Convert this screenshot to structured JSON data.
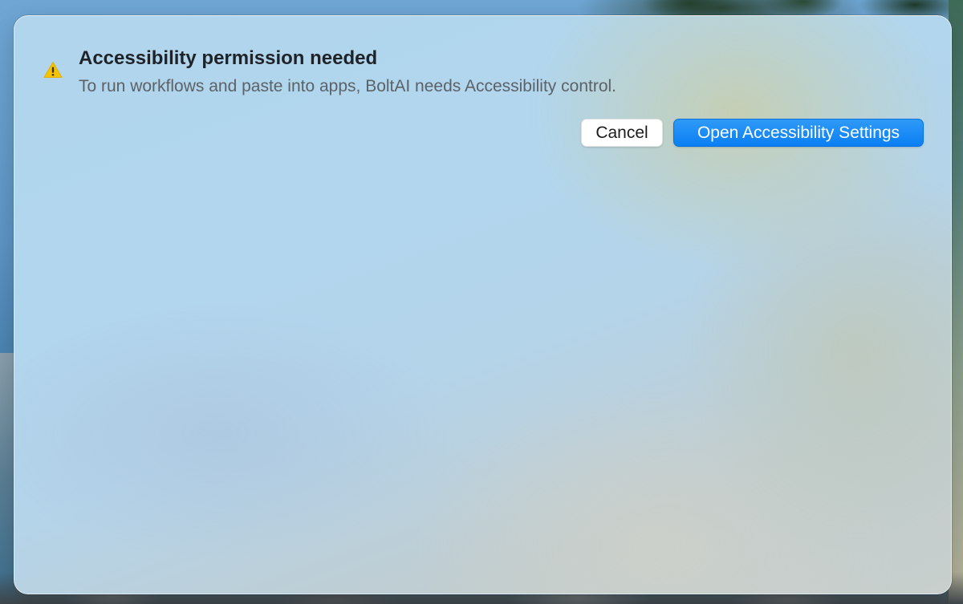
{
  "alert": {
    "icon": "warning-triangle-icon",
    "icon_color": "#f5c400",
    "title": "Accessibility permission needed",
    "message": "To run workflows and paste into apps, BoltAI needs Accessibility control."
  },
  "buttons": {
    "cancel_label": "Cancel",
    "primary_label": "Open Accessibility Settings",
    "primary_color": "#0a7ff3"
  }
}
